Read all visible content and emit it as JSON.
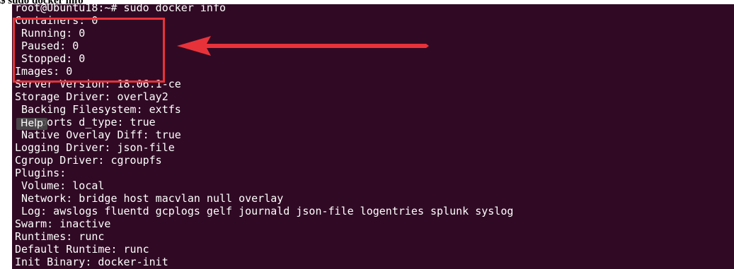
{
  "caption": "$ sudo docker info",
  "colors": {
    "terminal_bg": "#300a24",
    "terminal_fg": "#ffffff",
    "annotation": "#e8323a"
  },
  "terminal": {
    "lines": [
      "root@Ubuntu18:~# sudo docker info",
      "Containers: 0",
      " Running: 0",
      " Paused: 0",
      " Stopped: 0",
      "Images: 0",
      "Server Version: 18.06.1-ce",
      "Storage Driver: overlay2",
      " Backing Filesystem: extfs",
      " Supports d_type: true",
      " Native Overlay Diff: true",
      "Logging Driver: json-file",
      "Cgroup Driver: cgroupfs",
      "Plugins:",
      " Volume: local",
      " Network: bridge host macvlan null overlay",
      " Log: awslogs fluentd gcplogs gelf journald json-file logentries splunk syslog",
      "Swarm: inactive",
      "Runtimes: runc",
      "Default Runtime: runc",
      "Init Binary: docker-init"
    ]
  },
  "tooltip": {
    "label": "Help"
  },
  "annotation": {
    "arrow_icon": "red-arrow-left-icon"
  }
}
